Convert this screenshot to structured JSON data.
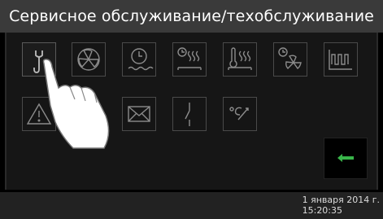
{
  "header": {
    "title": "Сервисное обслуживание/техобслуживание"
  },
  "tiles": [
    {
      "name": "wrench-icon",
      "selected": true
    },
    {
      "name": "fan-icon"
    },
    {
      "name": "timer-water-icon"
    },
    {
      "name": "timer-heat-icon"
    },
    {
      "name": "thermometer-heat-icon"
    },
    {
      "name": "timer-fan-icon"
    },
    {
      "name": "temperature-graph-icon"
    },
    {
      "name": "warning-icon"
    },
    {
      "name": "tile-hidden"
    },
    {
      "name": "envelope-icon"
    },
    {
      "name": "switch-icon"
    },
    {
      "name": "temperature-sensor-icon"
    }
  ],
  "footer": {
    "date": "1 января 2014 г.",
    "time": "15:20:35"
  },
  "colors": {
    "accent_green": "#39b54a",
    "icon_stroke": "#8c8c8c",
    "title_bar": "#3a3a3a"
  }
}
